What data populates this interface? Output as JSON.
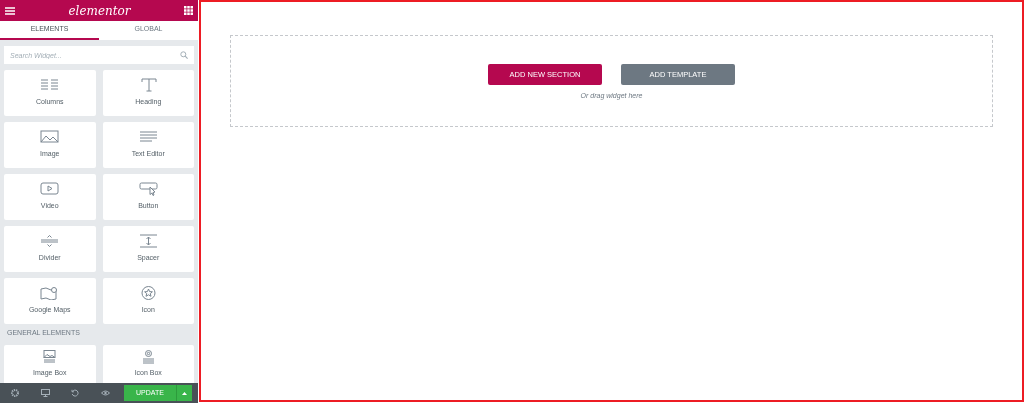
{
  "panel": {
    "logo": "elementor",
    "tabs": [
      {
        "label": "ELEMENTS",
        "selected": true
      },
      {
        "label": "GLOBAL",
        "selected": false
      }
    ],
    "search": {
      "placeholder": "Search Widget..."
    },
    "widgets": [
      {
        "label": "Columns"
      },
      {
        "label": "Heading"
      },
      {
        "label": "Image"
      },
      {
        "label": "Text Editor"
      },
      {
        "label": "Video"
      },
      {
        "label": "Button"
      },
      {
        "label": "Divider"
      },
      {
        "label": "Spacer"
      },
      {
        "label": "Google Maps"
      },
      {
        "label": "Icon"
      }
    ],
    "section_title": "GENERAL ELEMENTS",
    "general_widgets": [
      {
        "label": "Image Box"
      },
      {
        "label": "Icon Box"
      }
    ],
    "footer": {
      "update_button": "UPDATE"
    }
  },
  "canvas": {
    "buttons": [
      {
        "label": "ADD NEW SECTION",
        "kind": "primary"
      },
      {
        "label": "ADD TEMPLATE",
        "kind": "secondary"
      }
    ],
    "hint": "Or drag widget here"
  }
}
